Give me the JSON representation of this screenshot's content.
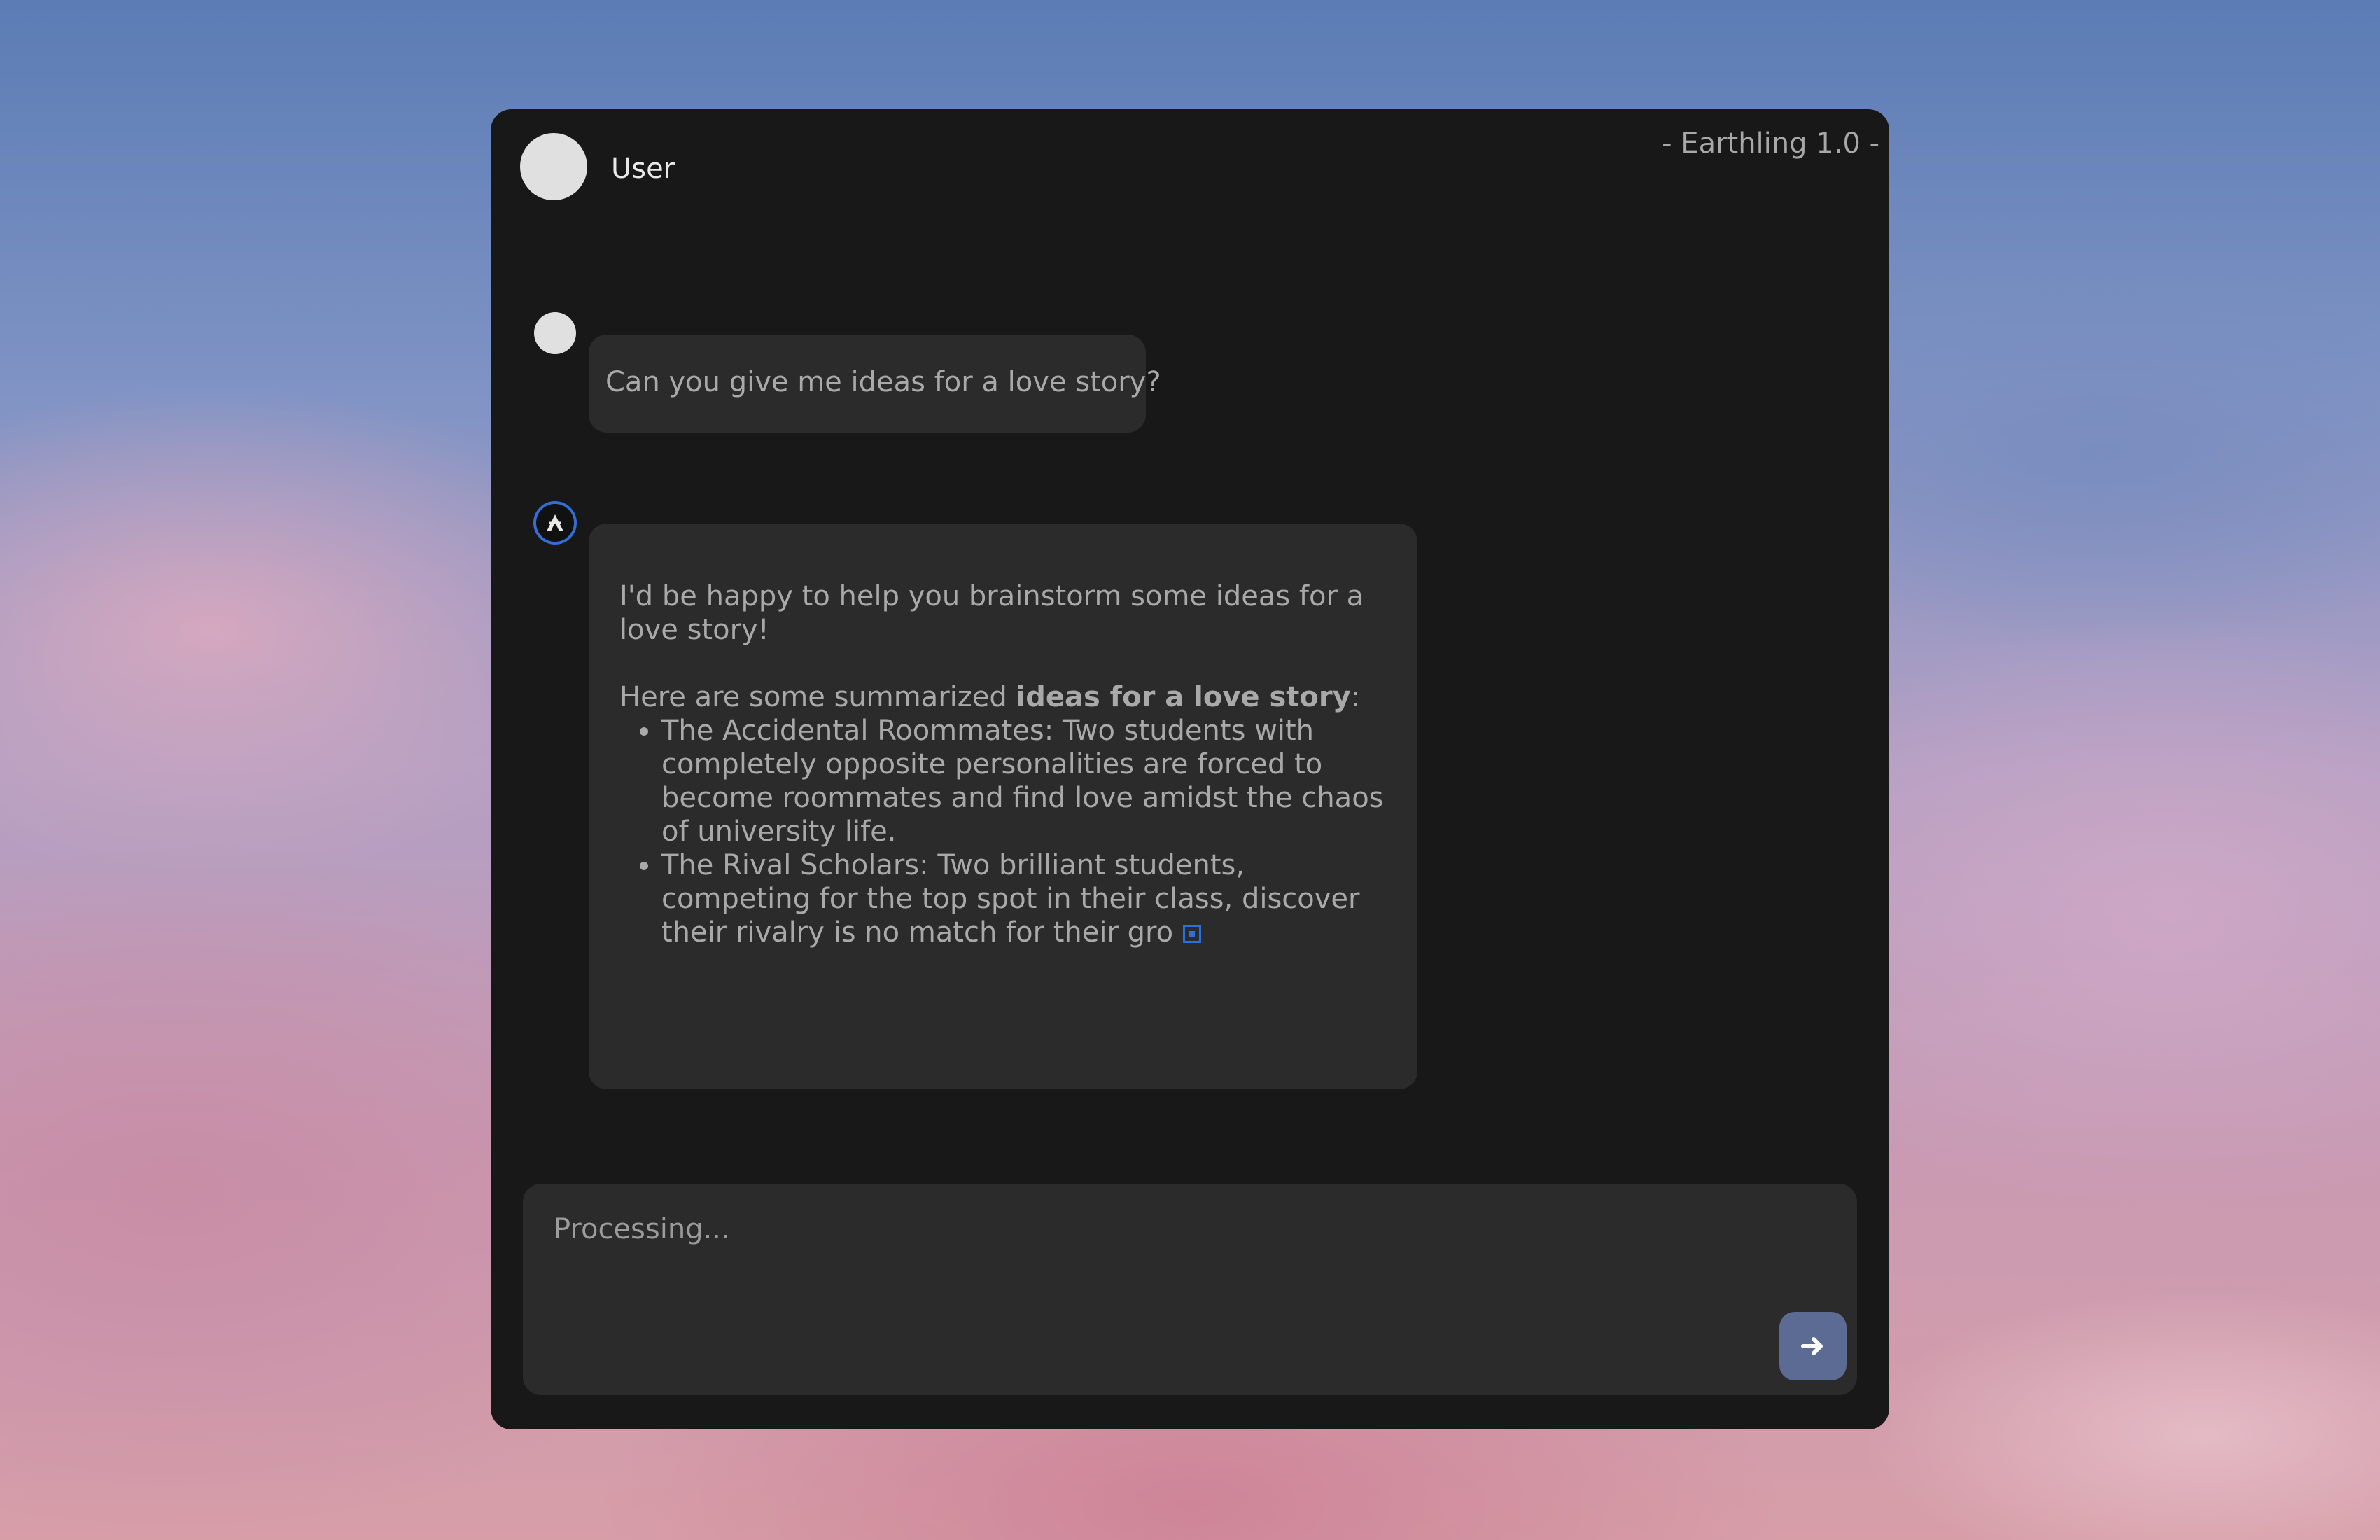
{
  "app": {
    "brand": "- Earthling 1.0 -",
    "user_name": "User"
  },
  "conversation": {
    "user_message": "Can you give me ideas for a love story?",
    "ai_intro": "I'd be happy to help you brainstorm some ideas for a love story!",
    "ai_summary_prefix": "Here are some summarized ",
    "ai_summary_bold": "ideas for a love story",
    "ai_summary_suffix": ":",
    "ideas": [
      "The Accidental Roommates: Two students with completely opposite personalities are forced to become roommates and find love amidst the chaos of university life.",
      "The Rival Scholars: Two brilliant students, competing for the top spot in their class, discover their rivalry is no match for their gro"
    ]
  },
  "composer": {
    "status_text": "Processing...",
    "send_icon": "arrow-right-icon"
  },
  "colors": {
    "window_bg": "#181818",
    "bubble_bg": "#2b2b2b",
    "accent_blue": "#2f6fd6",
    "send_button": "#5c6b94"
  }
}
